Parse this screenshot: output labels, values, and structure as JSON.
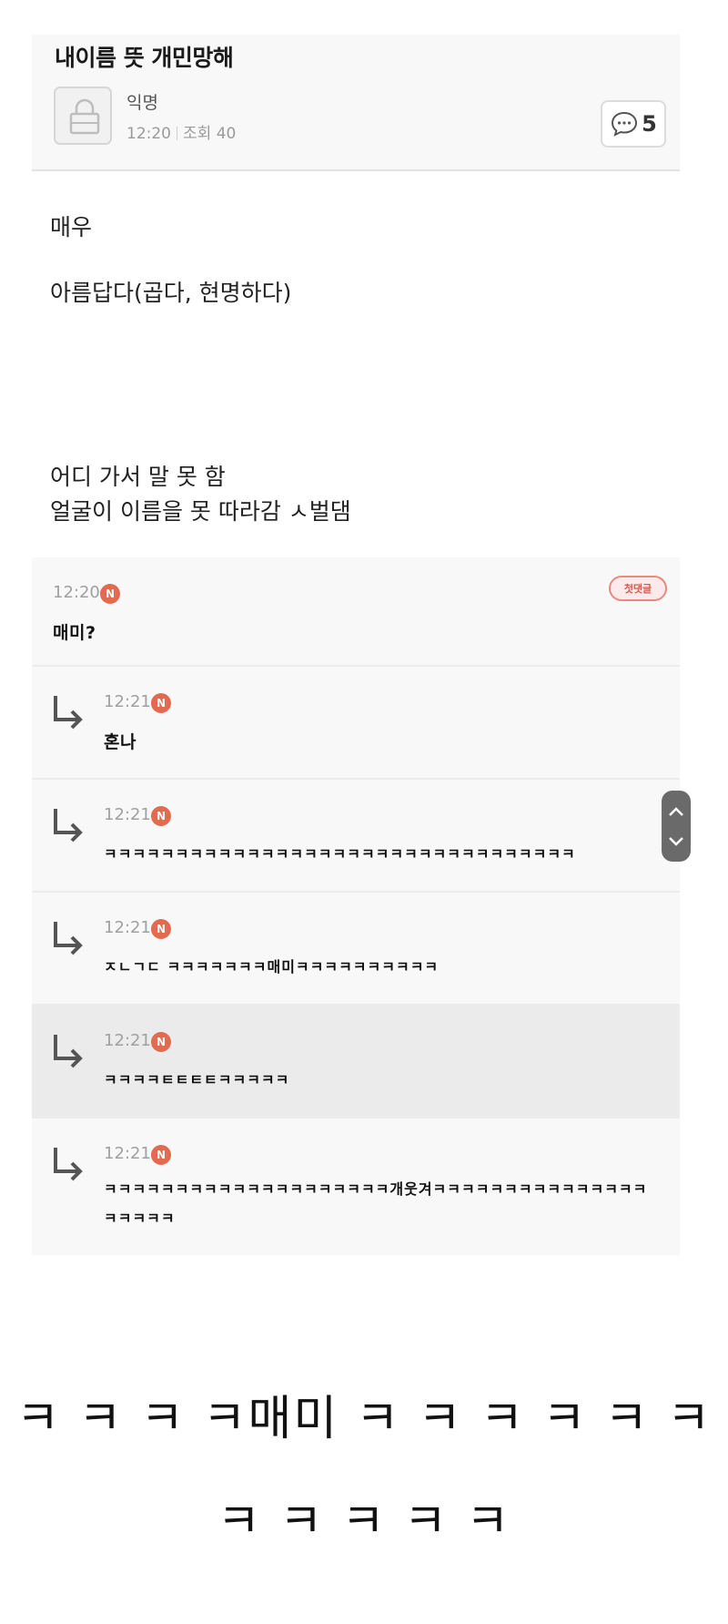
{
  "post": {
    "title": "내이름 뜻 개민망해",
    "author": "익명",
    "time": "12:20",
    "views_label": "조회",
    "views": "40",
    "comment_count": "5"
  },
  "body": {
    "line1": "매우",
    "line2": "아름답다(곱다, 현명하다)",
    "line3": "어디 가서 말 못 함",
    "line4": "얼굴이 이름을 못 따라감 ㅅ벌댐"
  },
  "comments": [
    {
      "time": "12:20",
      "badge": "N",
      "text": "매미?",
      "tag": "첫댓글"
    },
    {
      "time": "12:21",
      "badge": "N",
      "text": "혼나"
    },
    {
      "time": "12:21",
      "badge": "N",
      "text": "ㅋㅋㅋㅋㅋㅋㅋㅋㅋㅋㅋㅋㅋㅋㅋㅋㅋㅋㅋㅋㅋㅋㅋㅋㅋㅋㅋㅋㅋㅋㅋㅋㅋ"
    },
    {
      "time": "12:21",
      "badge": "N",
      "text": "ㅈㄴㄱㄷ ㅋㅋㅋㅋㅋㅋㅋ매미ㅋㅋㅋㅋㅋㅋㅋㅋㅋㅋ"
    },
    {
      "time": "12:21",
      "badge": "N",
      "text": "ㅋㅋㅋㅋㅌㅌㅌㅌㅋㅋㅋㅋㅋ"
    },
    {
      "time": "12:21",
      "badge": "N",
      "text": "ㅋㅋㅋㅋㅋㅋㅋㅋㅋㅋㅋㅋㅋㅋㅋㅋㅋㅋㅋㅋ개웃겨ㅋㅋㅋㅋㅋㅋㅋㅋㅋㅋㅋㅋㅋㅋㅋㅋㅋㅋㅋㅋ"
    }
  ],
  "caption": {
    "line1": "ㅋ ㅋ ㅋ ㅋ매미 ㅋ ㅋ ㅋ ㅋ ㅋ ㅋ",
    "line2": "ㅋ ㅋ ㅋ ㅋ ㅋ"
  },
  "colors": {
    "badge": "#e26a4e",
    "first_comment_badge": "#d45a4f",
    "highlight_row": "#ebebeb"
  },
  "icons": {
    "avatar": "lock-icon",
    "comment": "speech-bubble-icon",
    "reply": "reply-arrow-icon",
    "scroll_up": "chevron-up-icon",
    "scroll_down": "chevron-down-icon"
  }
}
